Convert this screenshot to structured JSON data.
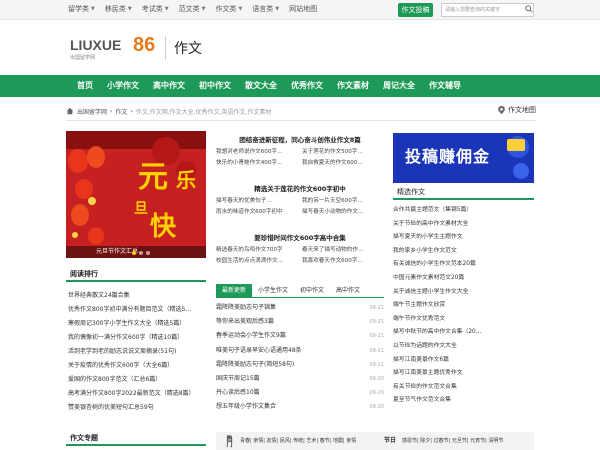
{
  "topbar": {
    "nav": [
      "留学类",
      "移民类",
      "考试类",
      "范文类",
      "作文类",
      "语言类",
      "网站地图"
    ],
    "contribute": "作文投稿",
    "search_placeholder": "请输入您要查询的关键字"
  },
  "header": {
    "logo_text": "LIUXUE",
    "logo_num": "86",
    "logo_sub": "出国留学网",
    "section_title": "作文"
  },
  "mainnav": [
    "首页",
    "小学作文",
    "高中作文",
    "初中作文",
    "散文大全",
    "优秀作文",
    "作文素材",
    "周记大全",
    "作文辅导"
  ],
  "breadcrumb": {
    "items": [
      "出国留学网",
      "作文"
    ],
    "keywords": "作文,作文网,作文大全,优秀作文,英语作文,作文素材",
    "sitemap": "作文地图"
  },
  "banner": {
    "caption": "元旦节作文汇总",
    "big1": "元",
    "big2": "乐",
    "small1": "旦",
    "small2": "快"
  },
  "ranking": {
    "title": "阅读排行",
    "items": [
      "世界经典散文24篇合集",
      "优秀作文800字初中满分有题目范文（精选5…",
      "寒假周记300字小学生作文大全（精选5篇）",
      "我的偶像初一满分作文600字（精选10篇）",
      "活到老学到老的励志说说文案摘录(51句)",
      "关于疫情的优秀作文600字（大全6篇）",
      "爱国的作文800字范文（汇总6篇）",
      "高考满分作文800字2022最新范文（精选8篇）",
      "赞美银杏树的优美短句汇总59句"
    ]
  },
  "topic": {
    "title": "作文专题"
  },
  "sections": [
    {
      "title": "团结奋进新征程，同心奋斗创伟业作文8篇",
      "rows": [
        [
          "我想对老师说作文600字…",
          "关于莲花的作文500字…"
        ],
        [
          "快乐的小青蛙作文400字…",
          "我自救夏天的作文600…"
        ]
      ]
    },
    {
      "title": "精选关于莲花的作文600字初中",
      "rows": [
        [
          "描写春天的优美句子…",
          "我的另一片天空600字…"
        ],
        [
          "雨水的味道作文600字初中",
          "描写春天小动物的作文…"
        ]
      ]
    },
    {
      "title": "要珍惜时间作文600字高中合集",
      "rows": [
        [
          "精选春天的鸟鸣作文700字",
          "春天来了描写动物的作…"
        ],
        [
          "校园生活的点点滴滴作文…",
          "我喜欢春天作文600字…"
        ]
      ]
    }
  ],
  "tabs": [
    "最新更新",
    "小学生作文",
    "初中作文",
    "高中作文"
  ],
  "latest": [
    {
      "title": "霜降降美励志句子锦集",
      "date": "09-21"
    },
    {
      "title": "等你来出美观后感3篇",
      "date": "09-21"
    },
    {
      "title": "春季运动会小学生作文9篇",
      "date": "09-21"
    },
    {
      "title": "唯美句子语录早安心语通用48条",
      "date": "09-21"
    },
    {
      "title": "霜降降美励志句子(简短58句)",
      "date": "09-21"
    },
    {
      "title": "国庆节周记15篇",
      "date": "09-20"
    },
    {
      "title": "丹心读后感10篇",
      "date": "09-20"
    },
    {
      "title": "想五年级小学作文集合",
      "date": "09-20"
    }
  ],
  "ad": {
    "text": "投稿赚佣金"
  },
  "recommend": {
    "title": "精选作文",
    "items": [
      "合作共赢主题范文（集锦5篇）",
      "关于节俭的高中作文素材大全",
      "描写夏天的小学生主题作文",
      "我的家乡小学生作文范文",
      "有关诚信的小学生作文范本20篇",
      "中国元素作文素材范文20篇",
      "关于诚信主题小学生作文大全",
      "端午节主题作文欣赏",
      "端午节作文优秀范文",
      "描写中秋节的高中作文合集（20…",
      "以节俭为话题的作文大全",
      "描写江南美景作文6篇",
      "描写江南美景主题优秀作文",
      "有关节俭的作文范文合集",
      "夏至节气作文范文合集"
    ]
  },
  "tagbar": {
    "label": "热门",
    "tags": "青春| 亲情| 友情| 民风| 传统| 艺术| 春节| 地震| 亲情",
    "label2": "节日",
    "tags2": "感恩节| 除夕| 过春节| 元旦节| 元宵节| 清明节"
  },
  "colors": {
    "brand_green": "#1d9a57",
    "logo_orange": "#e67c1a",
    "ad_blue": "#1a35b8",
    "banner_red": "#c22222"
  }
}
